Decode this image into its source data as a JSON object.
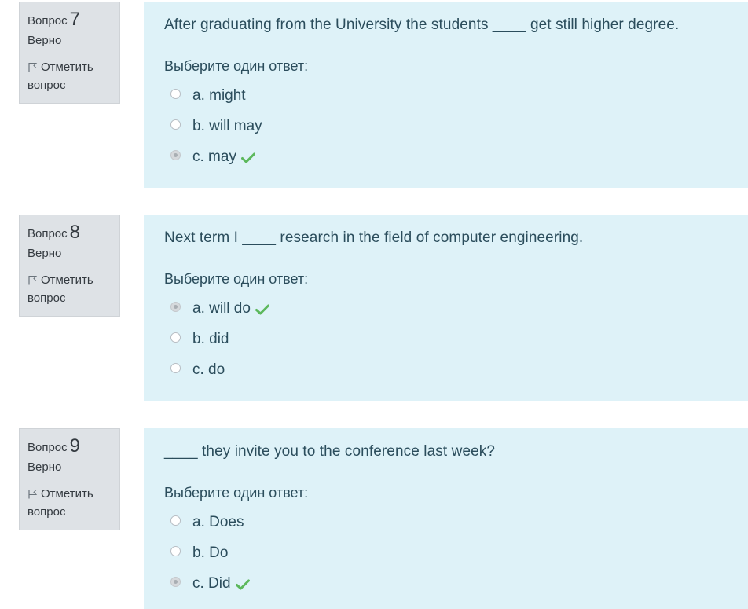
{
  "questions": [
    {
      "label": "Вопрос",
      "number": "7",
      "state": "Верно",
      "flag_label": "Отметить вопрос",
      "text": "After graduating from the University the students ____ get still higher degree.",
      "prompt": "Выберите один ответ:",
      "answers": [
        {
          "text": "a. might",
          "selected": false,
          "correct_mark": false
        },
        {
          "text": "b. will may",
          "selected": false,
          "correct_mark": false
        },
        {
          "text": "c. may",
          "selected": true,
          "correct_mark": true
        }
      ]
    },
    {
      "label": "Вопрос",
      "number": "8",
      "state": "Верно",
      "flag_label": "Отметить вопрос",
      "text": "Next term I ____ research in the field of computer engineering.",
      "prompt": "Выберите один ответ:",
      "answers": [
        {
          "text": "a. will do",
          "selected": true,
          "correct_mark": true
        },
        {
          "text": "b. did",
          "selected": false,
          "correct_mark": false
        },
        {
          "text": "c. do",
          "selected": false,
          "correct_mark": false
        }
      ]
    },
    {
      "label": "Вопрос",
      "number": "9",
      "state": "Верно",
      "flag_label": "Отметить вопрос",
      "text": "____ they invite you to the conference last week?",
      "prompt": "Выберите один ответ:",
      "answers": [
        {
          "text": "a. Does",
          "selected": false,
          "correct_mark": false
        },
        {
          "text": "b. Do",
          "selected": false,
          "correct_mark": false
        },
        {
          "text": "c. Did",
          "selected": true,
          "correct_mark": true
        }
      ]
    }
  ],
  "colors": {
    "info_bg": "#dee2e6",
    "content_bg": "#def2f8",
    "text": "#2b4d5c",
    "correct": "#5cb85c"
  },
  "icons": {
    "flag": "flag-icon",
    "correct": "check-icon"
  }
}
